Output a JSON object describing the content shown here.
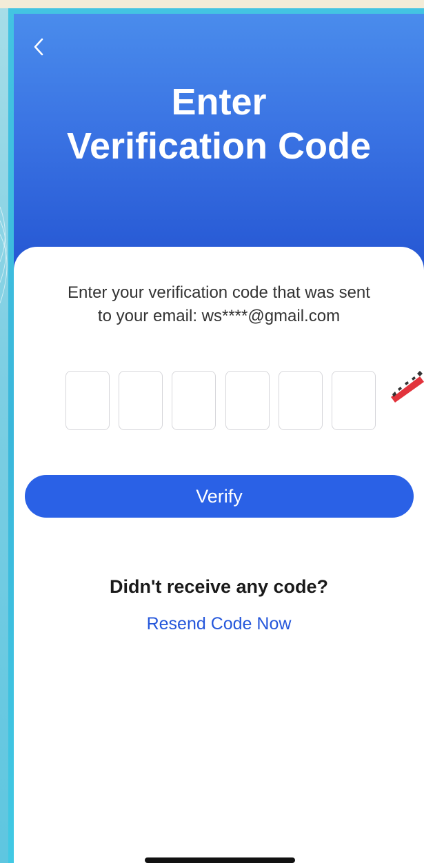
{
  "header": {
    "back_icon": "chevron-left-icon",
    "title_line1": "Enter",
    "title_line2": "Verification Code"
  },
  "form": {
    "instructions_line1": "Enter your verification code that was sent",
    "instructions_line2": "to your email: ws****@gmail.com",
    "code_boxes": [
      "",
      "",
      "",
      "",
      "",
      ""
    ],
    "verify_label": "Verify"
  },
  "footer": {
    "no_code_text": "Didn't receive any code?",
    "resend_label": "Resend Code Now"
  },
  "colors": {
    "primary": "#2a61e6",
    "header_top": "#4a8cec",
    "header_bottom": "#2455d2",
    "link": "#2557db",
    "frame_accent": "#43c4e2"
  }
}
